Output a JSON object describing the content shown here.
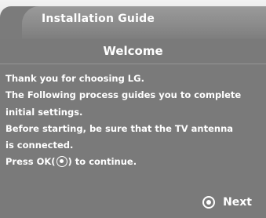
{
  "header": {
    "title": "Installation Guide"
  },
  "dialog": {
    "heading": "Welcome",
    "lines": [
      "Thank you for choosing LG.",
      "The Following process guides you to complete",
      "initial settings.",
      "Before starting, be sure that the TV antenna",
      "is connected."
    ],
    "instruction": {
      "before": "Press OK(",
      "after": ") to continue.",
      "icon": "ok-button-icon"
    }
  },
  "footer": {
    "next_label": "Next",
    "next_icon": "ok-button-icon"
  },
  "colors": {
    "panel": "#7b7b7b",
    "title_tab": "#8c8c8c",
    "text": "#ffffff"
  }
}
